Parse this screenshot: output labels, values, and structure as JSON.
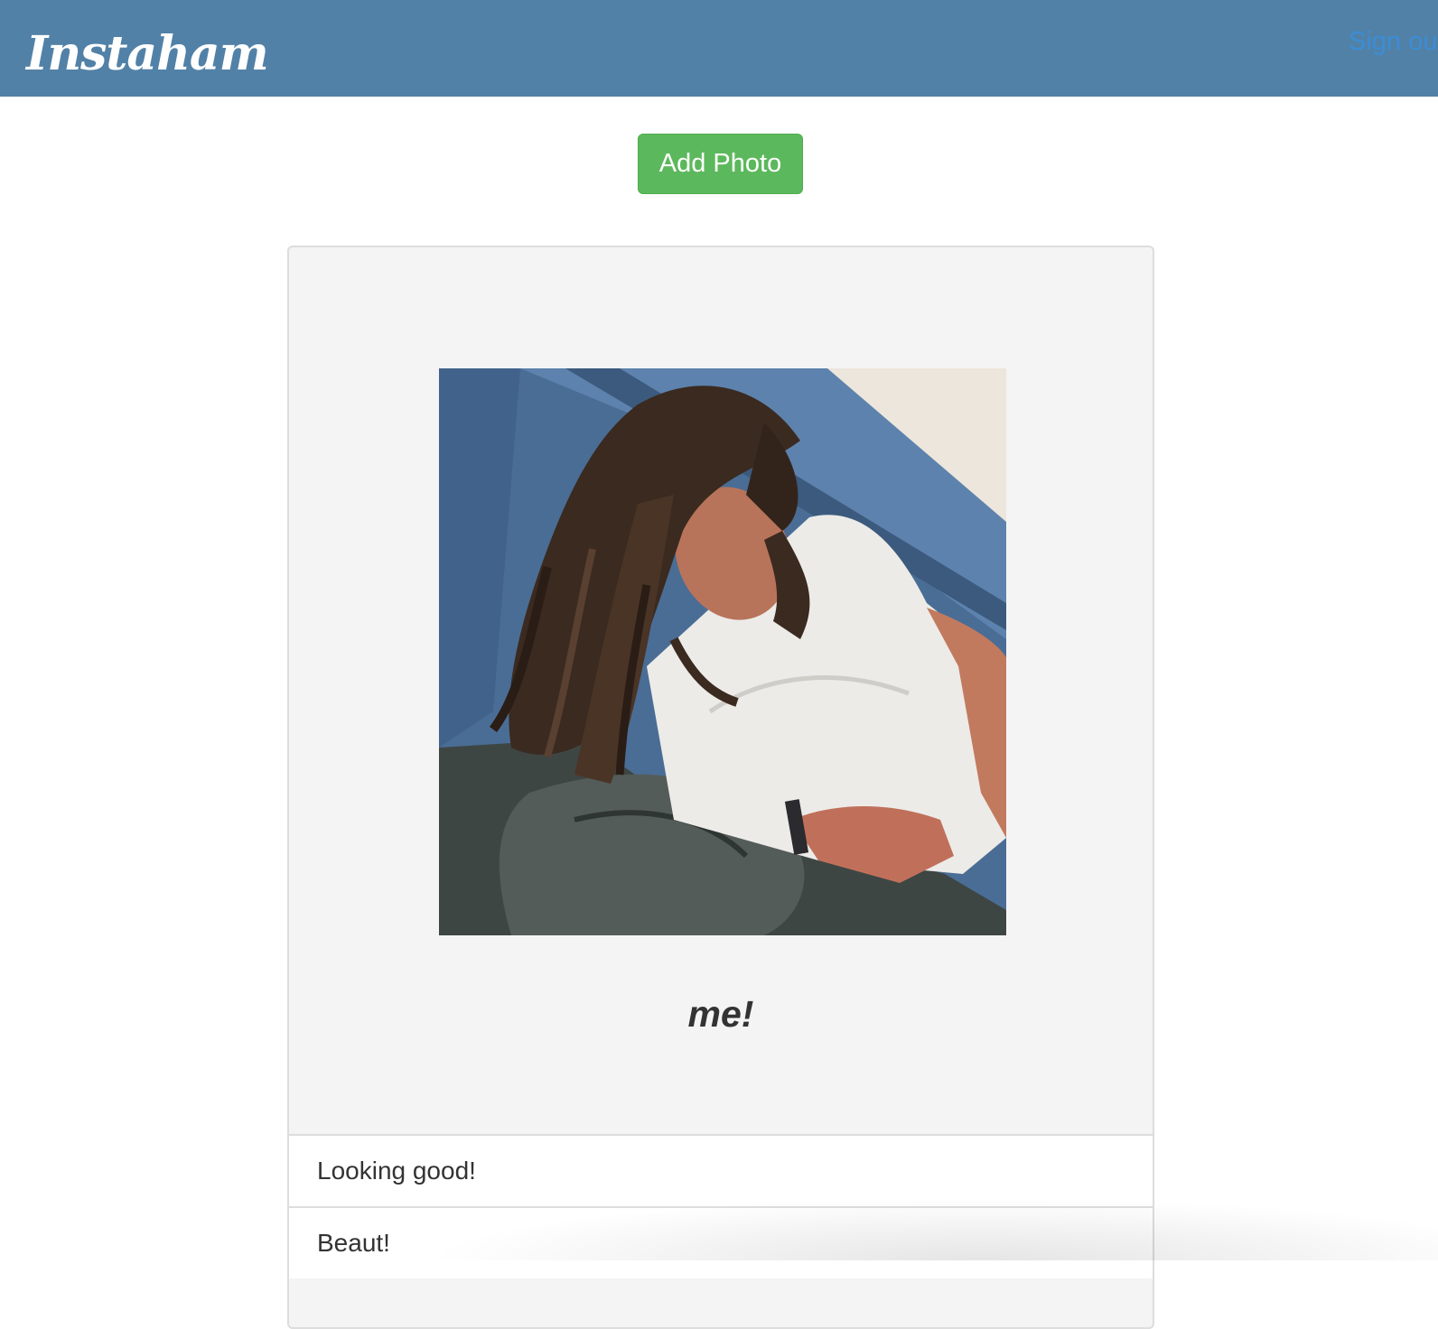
{
  "navbar": {
    "brand": "Instaham",
    "signout_label": "Sign ou",
    "background_color": "#5281a7"
  },
  "toolbar": {
    "add_photo_label": "Add Photo",
    "button_color": "#5cb85c"
  },
  "post": {
    "caption": "me!",
    "comments": [
      {
        "text": "Looking good!"
      },
      {
        "text": "Beaut!"
      }
    ]
  }
}
